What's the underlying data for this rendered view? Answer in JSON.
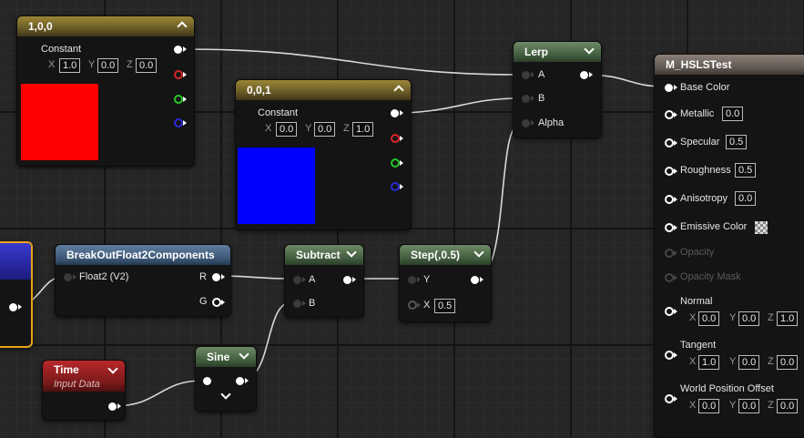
{
  "colors": {
    "wire": "#d9d9d9",
    "constant_red": "#ff0000",
    "constant_blue": "#0000ff",
    "selection": "#e8a218"
  },
  "nodes": {
    "constant_100": {
      "title": "1,0,0",
      "row_label": "Constant",
      "x_label": "X",
      "x_value": "1.0",
      "y_label": "Y",
      "y_value": "0.0",
      "z_label": "Z",
      "z_value": "0.0"
    },
    "constant_001": {
      "title": "0,0,1",
      "row_label": "Constant",
      "x_label": "X",
      "x_value": "0.0",
      "y_label": "Y",
      "y_value": "0.0",
      "z_label": "Z",
      "z_value": "1.0"
    },
    "lerp": {
      "title": "Lerp",
      "pin_a": "A",
      "pin_b": "B",
      "pin_alpha": "Alpha"
    },
    "breakout": {
      "title": "BreakOutFloat2Components",
      "input": "Float2 (V2)",
      "out_r": "R",
      "out_g": "G"
    },
    "subtract": {
      "title": "Subtract",
      "pin_a": "A",
      "pin_b": "B"
    },
    "step": {
      "title": "Step(,0.5)",
      "pin_y": "Y",
      "pin_x": "X",
      "x_value": "0.5"
    },
    "time": {
      "title": "Time",
      "subtitle": "Input Data"
    },
    "sine": {
      "title": "Sine"
    },
    "material": {
      "title": "M_HSLSTest",
      "base_color": "Base Color",
      "metallic": "Metallic",
      "metallic_value": "0.0",
      "specular": "Specular",
      "specular_value": "0.5",
      "roughness": "Roughness",
      "roughness_value": "0.5",
      "anisotropy": "Anisotropy",
      "anisotropy_value": "0.0",
      "emissive": "Emissive Color",
      "opacity": "Opacity",
      "opacity_mask": "Opacity Mask",
      "normal": "Normal",
      "normal_x": "0.0",
      "normal_y": "0.0",
      "normal_z": "1.0",
      "tangent": "Tangent",
      "tangent_x": "1.0",
      "tangent_y": "0.0",
      "tangent_z": "0.0",
      "wpo": "World Position Offset",
      "wpo_x": "0.0",
      "wpo_y": "0.0",
      "wpo_z": "0.0",
      "axis_x": "X",
      "axis_y": "Y",
      "axis_z": "Z"
    }
  }
}
